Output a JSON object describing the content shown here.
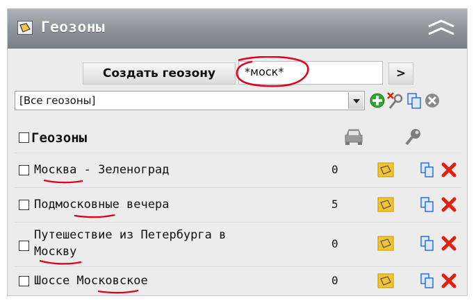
{
  "panel": {
    "title": "Геозоны",
    "icons": {
      "title": "geozone-icon",
      "collapse": "double-chevron-up-icon"
    }
  },
  "create": {
    "button_label": "Создать геозону",
    "name_value": "*моск*",
    "go_label": ">"
  },
  "filter": {
    "selected": "[Все геозоны]",
    "toolbar_icons": [
      "add-icon",
      "remove-key-icon",
      "copy-icon",
      "close-circle-icon"
    ]
  },
  "table": {
    "header_label": "Геозоны",
    "column_icons": [
      "car-icon",
      "key-icon"
    ],
    "rows": [
      {
        "name": "Москва - Зеленоград",
        "count": "0"
      },
      {
        "name": "Подмосковные вечера",
        "count": "5"
      },
      {
        "name": "Путешествие из Петербурга в\nМоскву",
        "count": "0"
      },
      {
        "name": "Шоссе Московское",
        "count": "0"
      }
    ]
  },
  "colors": {
    "title_bar": "#8d9298",
    "panel_bg": "#ececec",
    "annotation_red": "#e0001b",
    "delete_red": "#e02010",
    "add_green": "#2fa82f",
    "geozone_yellow": "#f4c430"
  }
}
